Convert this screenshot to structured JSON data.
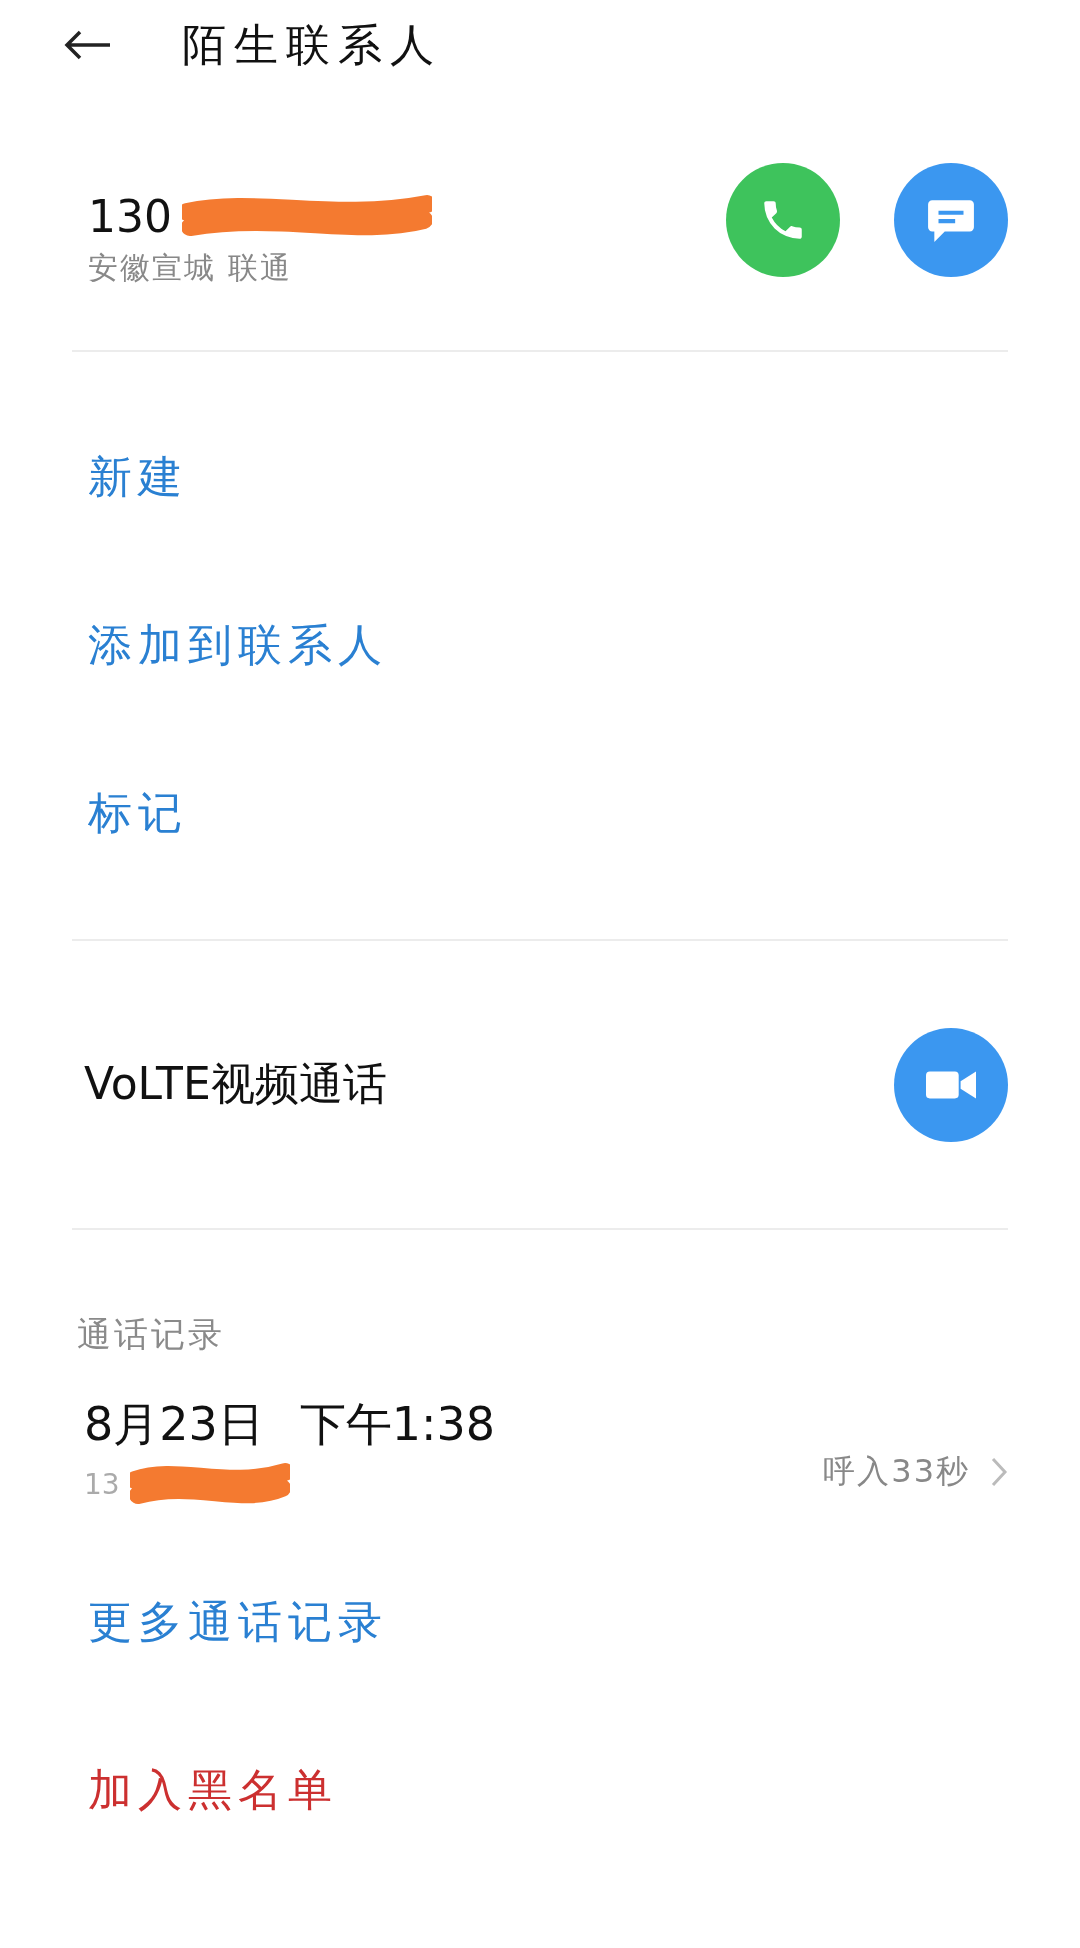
{
  "header": {
    "title": "陌生联系人"
  },
  "contact": {
    "number": "130",
    "location": "安徽宣城 联通"
  },
  "actions": [
    {
      "label": "新建"
    },
    {
      "label": "添加到联系人"
    },
    {
      "label": "标记"
    }
  ],
  "video_call": {
    "label": "VoLTE视频通话"
  },
  "call_log": {
    "heading": "通话记录",
    "entries": [
      {
        "date": "8月23日",
        "time": "下午1:38",
        "number": "13",
        "detail": "呼入33秒"
      }
    ],
    "more": "更多通话记录"
  },
  "blacklist": {
    "label": "加入黑名单"
  }
}
